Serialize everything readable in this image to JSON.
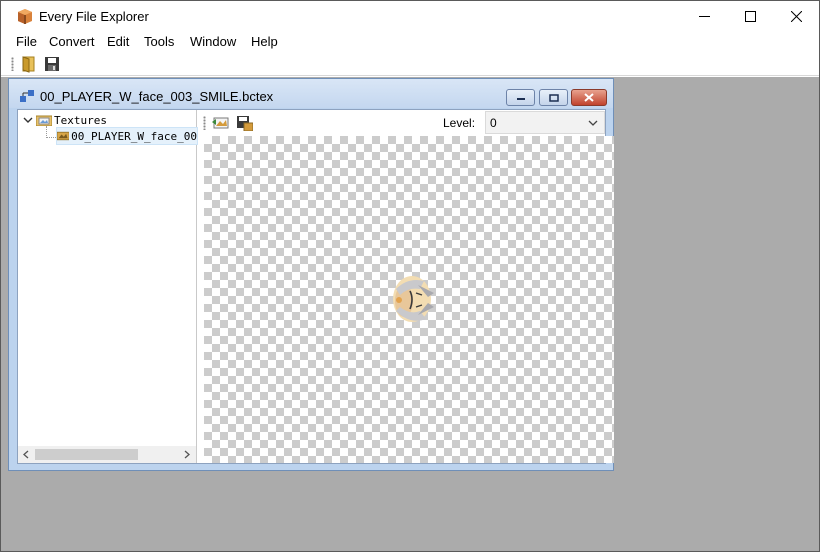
{
  "app": {
    "title": "Every File Explorer",
    "icon": "package-icon"
  },
  "window_controls": [
    "minimize-icon",
    "maximize-icon",
    "close-icon"
  ],
  "menu": {
    "items": [
      "File",
      "Convert",
      "Edit",
      "Tools",
      "Window",
      "Help"
    ]
  },
  "toolbar": {
    "buttons": [
      "open-folder-icon",
      "save-icon"
    ]
  },
  "child_window": {
    "title": "00_PLAYER_W_face_003_SMILE.bctex",
    "icon": "file-tree-icon",
    "controls": [
      "minimize-icon",
      "restore-icon",
      "close-icon"
    ]
  },
  "tree": {
    "root": {
      "label": "Textures",
      "expanded": true,
      "icon": "image-folder-icon"
    },
    "children": [
      {
        "label": "00_PLAYER_W_face_00",
        "selected": true,
        "icon": "texture-icon"
      }
    ]
  },
  "viewer": {
    "toolbar_buttons": [
      "export-image-icon",
      "save-image-icon"
    ],
    "level_label": "Level:",
    "level_value": "0"
  },
  "colors": {
    "mdi_background": "#ababab",
    "child_frame": "#bcd3ee",
    "close_button": "#c1432d",
    "selection": "#e5f1fb"
  }
}
